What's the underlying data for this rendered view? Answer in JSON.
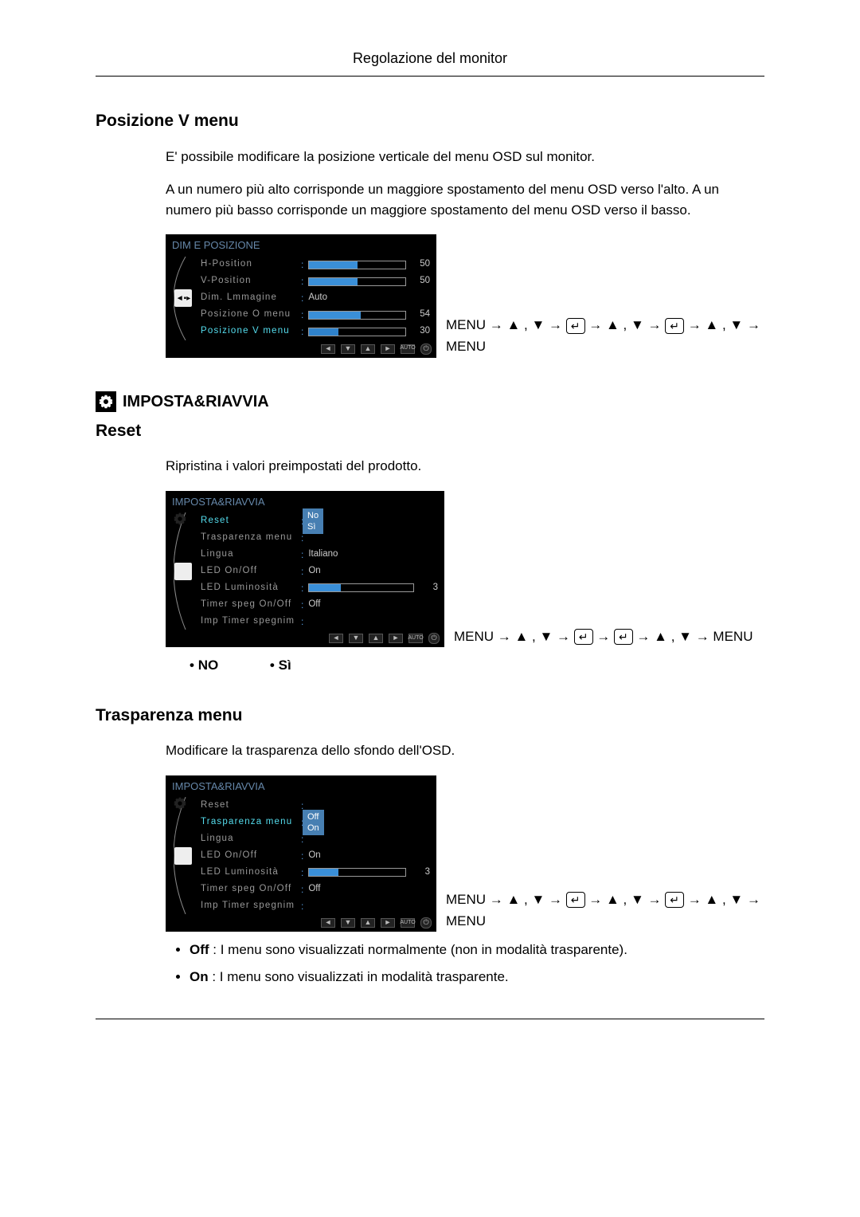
{
  "page_header": "Regolazione del monitor",
  "sec1": {
    "title": "Posizione V menu",
    "p1": "E' possibile modificare la posizione verticale del menu OSD sul monitor.",
    "p2": "A un numero più alto corrisponde un maggiore spostamento del menu OSD verso l'alto. A un numero più basso corrisponde un maggiore spostamento del menu OSD verso il basso."
  },
  "osd1": {
    "title": "DIM E POSIZIONE",
    "rows": [
      {
        "label": "H-Position",
        "type": "slider",
        "value": 50
      },
      {
        "label": "V-Position",
        "type": "slider",
        "value": 50
      },
      {
        "label": "Dim. Lmmagine",
        "type": "text",
        "value": "Auto"
      },
      {
        "label": "Posizione O menu",
        "type": "slider",
        "value": 54
      },
      {
        "label": "Posizione V menu",
        "type": "slider",
        "value": 30,
        "sel": true
      }
    ],
    "nav": "MENU → ▲ , ▼ → {E} → ▲ , ▼ → {E} → ▲ , ▼ → MENU"
  },
  "sec2_head": "IMPOSTA&RIAVVIA",
  "sec2": {
    "title": "Reset",
    "p": "Ripristina i valori preimpostati del prodotto."
  },
  "osd2": {
    "title": "IMPOSTA&RIAVVIA",
    "rows": [
      {
        "label": "Reset",
        "type": "dropdown",
        "sel": true
      },
      {
        "label": "Trasparenza menu",
        "type": "blank"
      },
      {
        "label": "Lingua",
        "type": "text",
        "value": "Italiano"
      },
      {
        "label": "LED On/Off",
        "type": "text",
        "value": "On"
      },
      {
        "label": "LED Luminosità",
        "type": "slider",
        "value": 3,
        "max": 10
      },
      {
        "label": "Timer speg On/Off",
        "type": "text",
        "value": "Off"
      },
      {
        "label": "Imp Timer spegnim",
        "type": "blank"
      }
    ],
    "dropdown": [
      "No",
      "Sì"
    ],
    "nav": "MENU → ▲ , ▼ → {E} → {E} → ▲ , ▼ → MENU"
  },
  "bullets_no": "NO",
  "bullets_si": "Sì",
  "sec3": {
    "title": "Trasparenza menu",
    "p": "Modificare la trasparenza dello sfondo dell'OSD."
  },
  "osd3": {
    "title": "IMPOSTA&RIAVVIA",
    "rows": [
      {
        "label": "Reset",
        "type": "blank"
      },
      {
        "label": "Trasparenza menu",
        "type": "dropdown",
        "sel": true
      },
      {
        "label": "Lingua",
        "type": "blank"
      },
      {
        "label": "LED On/Off",
        "type": "text",
        "value": "On"
      },
      {
        "label": "LED Luminosità",
        "type": "slider",
        "value": 3,
        "max": 10
      },
      {
        "label": "Timer speg On/Off",
        "type": "text",
        "value": "Off"
      },
      {
        "label": "Imp Timer spegnim",
        "type": "blank"
      }
    ],
    "dropdown": [
      "Off",
      "On"
    ],
    "nav": "MENU → ▲ , ▼ → {E} → ▲ , ▼ → {E} → ▲ , ▼ → MENU"
  },
  "trasp_bullets": [
    {
      "b": "Off",
      "t": " : I menu sono visualizzati normalmente (non in modalità trasparente)."
    },
    {
      "b": "On",
      "t": " : I menu sono visualizzati in modalità trasparente."
    }
  ]
}
